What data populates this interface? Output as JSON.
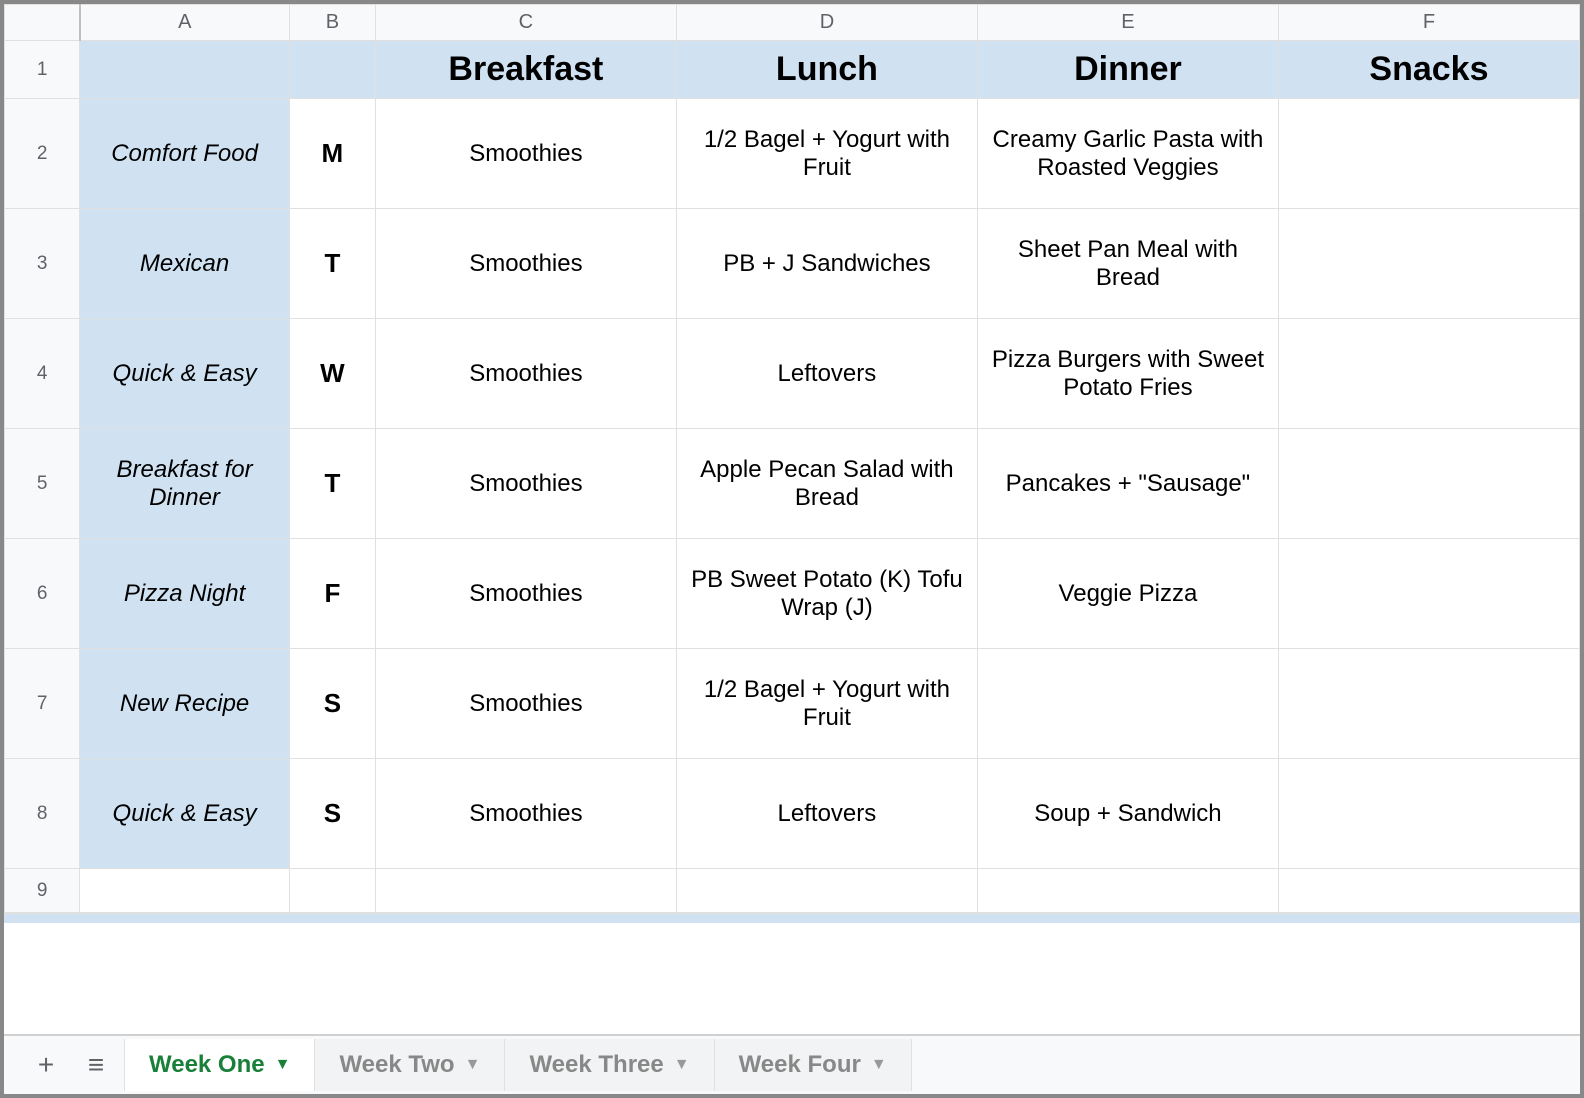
{
  "columns": [
    "A",
    "B",
    "C",
    "D",
    "E",
    "F"
  ],
  "headerRow": {
    "rowNum": "1",
    "cells": [
      "",
      "",
      "Breakfast",
      "Lunch",
      "Dinner",
      "Snacks"
    ]
  },
  "rows": [
    {
      "rowNum": "2",
      "theme": "Comfort Food",
      "day": "M",
      "breakfast": "Smoothies",
      "lunch": "1/2 Bagel + Yogurt with Fruit",
      "dinner": "Creamy Garlic Pasta with Roasted Veggies",
      "snacks": ""
    },
    {
      "rowNum": "3",
      "theme": "Mexican",
      "day": "T",
      "breakfast": "Smoothies",
      "lunch": "PB + J Sandwiches",
      "dinner": "Sheet Pan Meal with Bread",
      "snacks": ""
    },
    {
      "rowNum": "4",
      "theme": "Quick & Easy",
      "day": "W",
      "breakfast": "Smoothies",
      "lunch": "Leftovers",
      "dinner": "Pizza Burgers with Sweet Potato Fries",
      "snacks": ""
    },
    {
      "rowNum": "5",
      "theme": "Breakfast for Dinner",
      "day": "T",
      "breakfast": "Smoothies",
      "lunch": "Apple Pecan Salad with Bread",
      "dinner": "Pancakes + \"Sausage\"",
      "snacks": ""
    },
    {
      "rowNum": "6",
      "theme": "Pizza Night",
      "day": "F",
      "breakfast": "Smoothies",
      "lunch": "PB Sweet Potato (K) Tofu Wrap (J)",
      "dinner": "Veggie Pizza",
      "snacks": ""
    },
    {
      "rowNum": "7",
      "theme": "New Recipe",
      "day": "S",
      "breakfast": "Smoothies",
      "lunch": "1/2 Bagel + Yogurt with Fruit",
      "dinner": "",
      "snacks": ""
    },
    {
      "rowNum": "8",
      "theme": "Quick & Easy",
      "day": "S",
      "breakfast": "Smoothies",
      "lunch": "Leftovers",
      "dinner": "Soup + Sandwich",
      "snacks": ""
    }
  ],
  "emptyRow": {
    "rowNum": "9"
  },
  "tabs": {
    "addIcon": "+",
    "menuIcon": "≡",
    "items": [
      {
        "label": "Week One",
        "active": true
      },
      {
        "label": "Week Two",
        "active": false
      },
      {
        "label": "Week Three",
        "active": false
      },
      {
        "label": "Week Four",
        "active": false
      }
    ]
  }
}
